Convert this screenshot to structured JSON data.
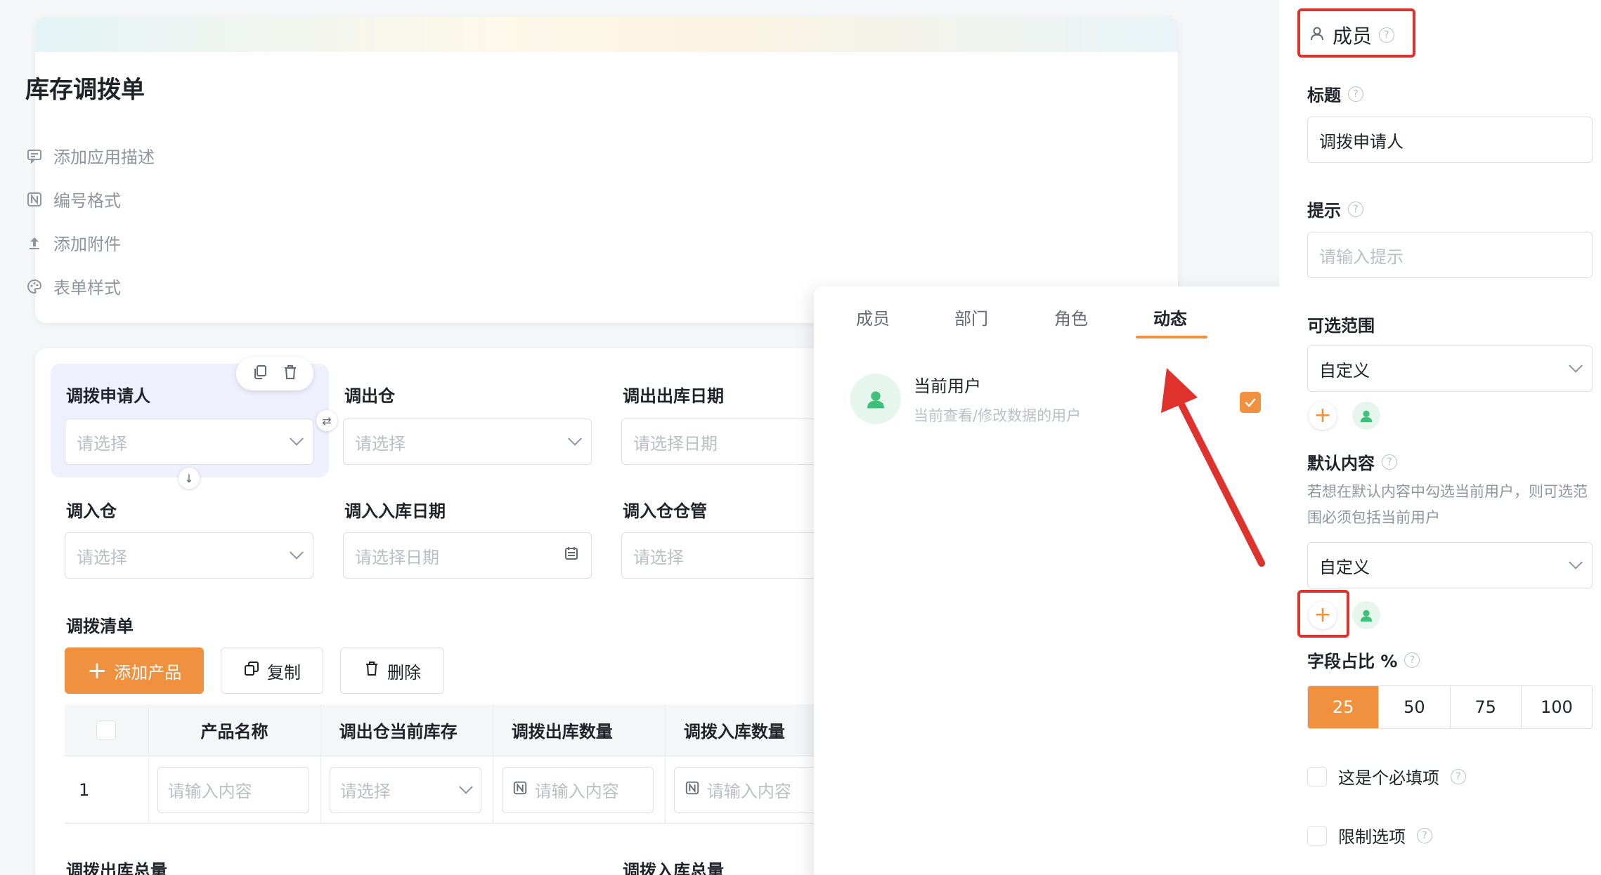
{
  "app": {
    "title": "库存调拨单",
    "meta": [
      "添加应用描述",
      "编号格式",
      "添加附件",
      "表单样式"
    ]
  },
  "form": {
    "fields": [
      {
        "label": "调拨申请人",
        "placeholder": "请选择"
      },
      {
        "label": "调出仓",
        "placeholder": "请选择"
      },
      {
        "label": "调出出库日期",
        "placeholder": "请选择日期"
      },
      {
        "label": "调入仓",
        "placeholder": "请选择"
      },
      {
        "label": "调入入库日期",
        "placeholder": "请选择日期"
      },
      {
        "label": "调入仓仓管",
        "placeholder": "请选择"
      }
    ],
    "list_title": "调拨清单",
    "buttons": {
      "add": "添加产品",
      "copy": "复制",
      "delete": "删除"
    },
    "table": {
      "headers": [
        "产品名称",
        "调出仓当前库存",
        "调拨出库数量",
        "调拨入库数量"
      ],
      "row": {
        "index": "1",
        "name_ph": "请输入内容",
        "stock_ph": "请选择",
        "out_ph": "请输入内容",
        "in_ph": "请输入内容"
      }
    },
    "totals": [
      "调拨出库总量",
      "调拨入库总量"
    ]
  },
  "popup": {
    "tabs": [
      "成员",
      "部门",
      "角色",
      "动态"
    ],
    "active_tab": "动态",
    "item": {
      "title": "当前用户",
      "desc": "当前查看/修改数据的用户",
      "checked": true
    }
  },
  "panel": {
    "header": "成员",
    "title_label": "标题",
    "title_value": "调拨申请人",
    "hint_label": "提示",
    "hint_placeholder": "请输入提示",
    "range_label": "可选范围",
    "range_value": "自定义",
    "default_label": "默认内容",
    "default_note": "若想在默认内容中勾选当前用户，则可选范围必须包括当前用户",
    "default_value": "自定义",
    "ratio_label": "字段占比 %",
    "ratio_options": [
      "25",
      "50",
      "75",
      "100"
    ],
    "ratio_selected": "25",
    "required_label": "这是个必填项",
    "limit_label": "限制选项"
  },
  "colors": {
    "accent": "#f0913f",
    "annotation": "#e0322c",
    "avatar": "#3ec07a"
  }
}
